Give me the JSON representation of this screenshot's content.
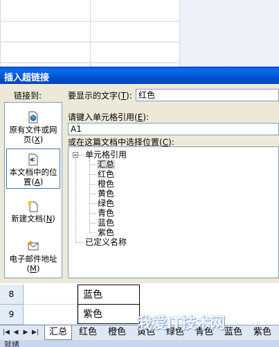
{
  "dialog": {
    "title": "插入超链接",
    "link_to_label": "链接到:",
    "display_text_label": "要显示的文字",
    "display_text_key": "T",
    "display_text_value": "红色",
    "cell_ref_label": "请键入单元格引用",
    "cell_ref_key": "E",
    "cell_ref_value": "A1",
    "place_label": "或在这篇文档中选择位置",
    "place_key": "C",
    "link_options": [
      {
        "line1": "原有文件或网",
        "line2": "页",
        "key": "X",
        "icon": "file-web-icon"
      },
      {
        "line1": "本文档中的位",
        "line2": "置",
        "key": "A",
        "icon": "document-place-icon",
        "selected": true
      },
      {
        "line1": "新建文档",
        "line2": "",
        "key": "N",
        "icon": "new-document-icon"
      },
      {
        "line1": "电子邮件地址",
        "line2": "",
        "key": "M",
        "icon": "email-icon"
      }
    ],
    "tree": {
      "root": "单元格引用",
      "children": [
        "汇总",
        "红色",
        "橙色",
        "黄色",
        "绿色",
        "青色",
        "蓝色",
        "紫色"
      ],
      "selected": "汇总",
      "defined_names": "已定义名称"
    }
  },
  "sheet": {
    "rows": [
      {
        "num": "8",
        "value": "蓝色"
      },
      {
        "num": "9",
        "value": "紫色"
      }
    ],
    "tabs": [
      "汇总",
      "红色",
      "橙色",
      "黄色",
      "绿色",
      "青色",
      "蓝色",
      "紫色"
    ],
    "active_tab": "汇总",
    "status": "就绪"
  },
  "watermark": "我爱IT技术网"
}
